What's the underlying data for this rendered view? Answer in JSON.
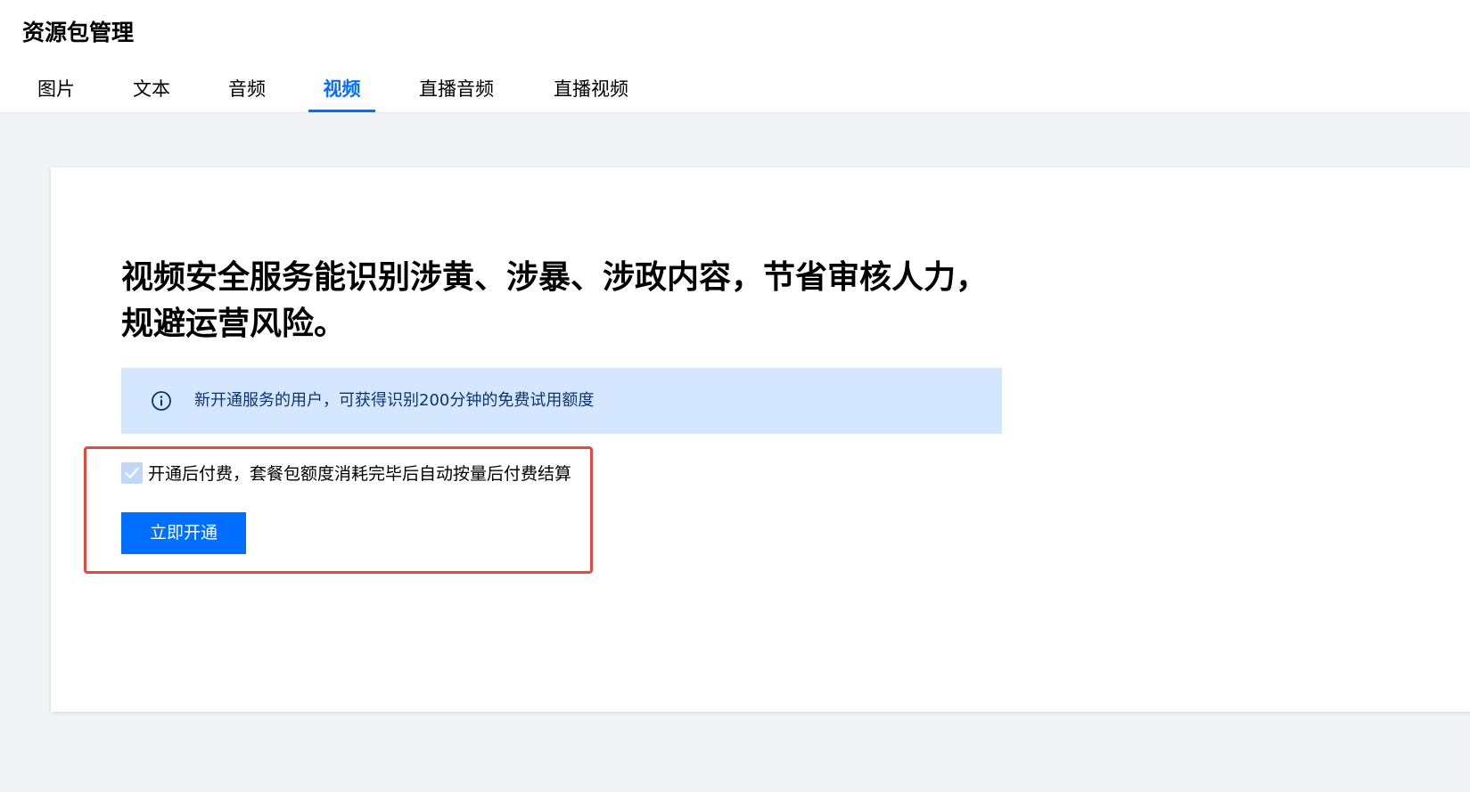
{
  "page": {
    "title": "资源包管理"
  },
  "tabs": [
    {
      "label": "图片",
      "active": false
    },
    {
      "label": "文本",
      "active": false
    },
    {
      "label": "音频",
      "active": false
    },
    {
      "label": "视频",
      "active": true
    },
    {
      "label": "直播音频",
      "active": false
    },
    {
      "label": "直播视频",
      "active": false
    }
  ],
  "main": {
    "headline": "视频安全服务能识别涉黄、涉暴、涉政内容，节省审核人力，规避运营风险。",
    "notice": {
      "icon": "info-icon",
      "text": "新开通服务的用户，可获得识别200分钟的免费试用额度"
    },
    "postpay": {
      "checked": true,
      "label": "开通后付费，套餐包额度消耗完毕后自动按量后付费结算"
    },
    "activate_button": "立即开通"
  },
  "colors": {
    "accent": "#006eff",
    "notice_bg": "#d5e7ff",
    "notice_text": "#0a3478",
    "highlight_border": "#e5483f",
    "page_bg": "#f2f3f6"
  }
}
